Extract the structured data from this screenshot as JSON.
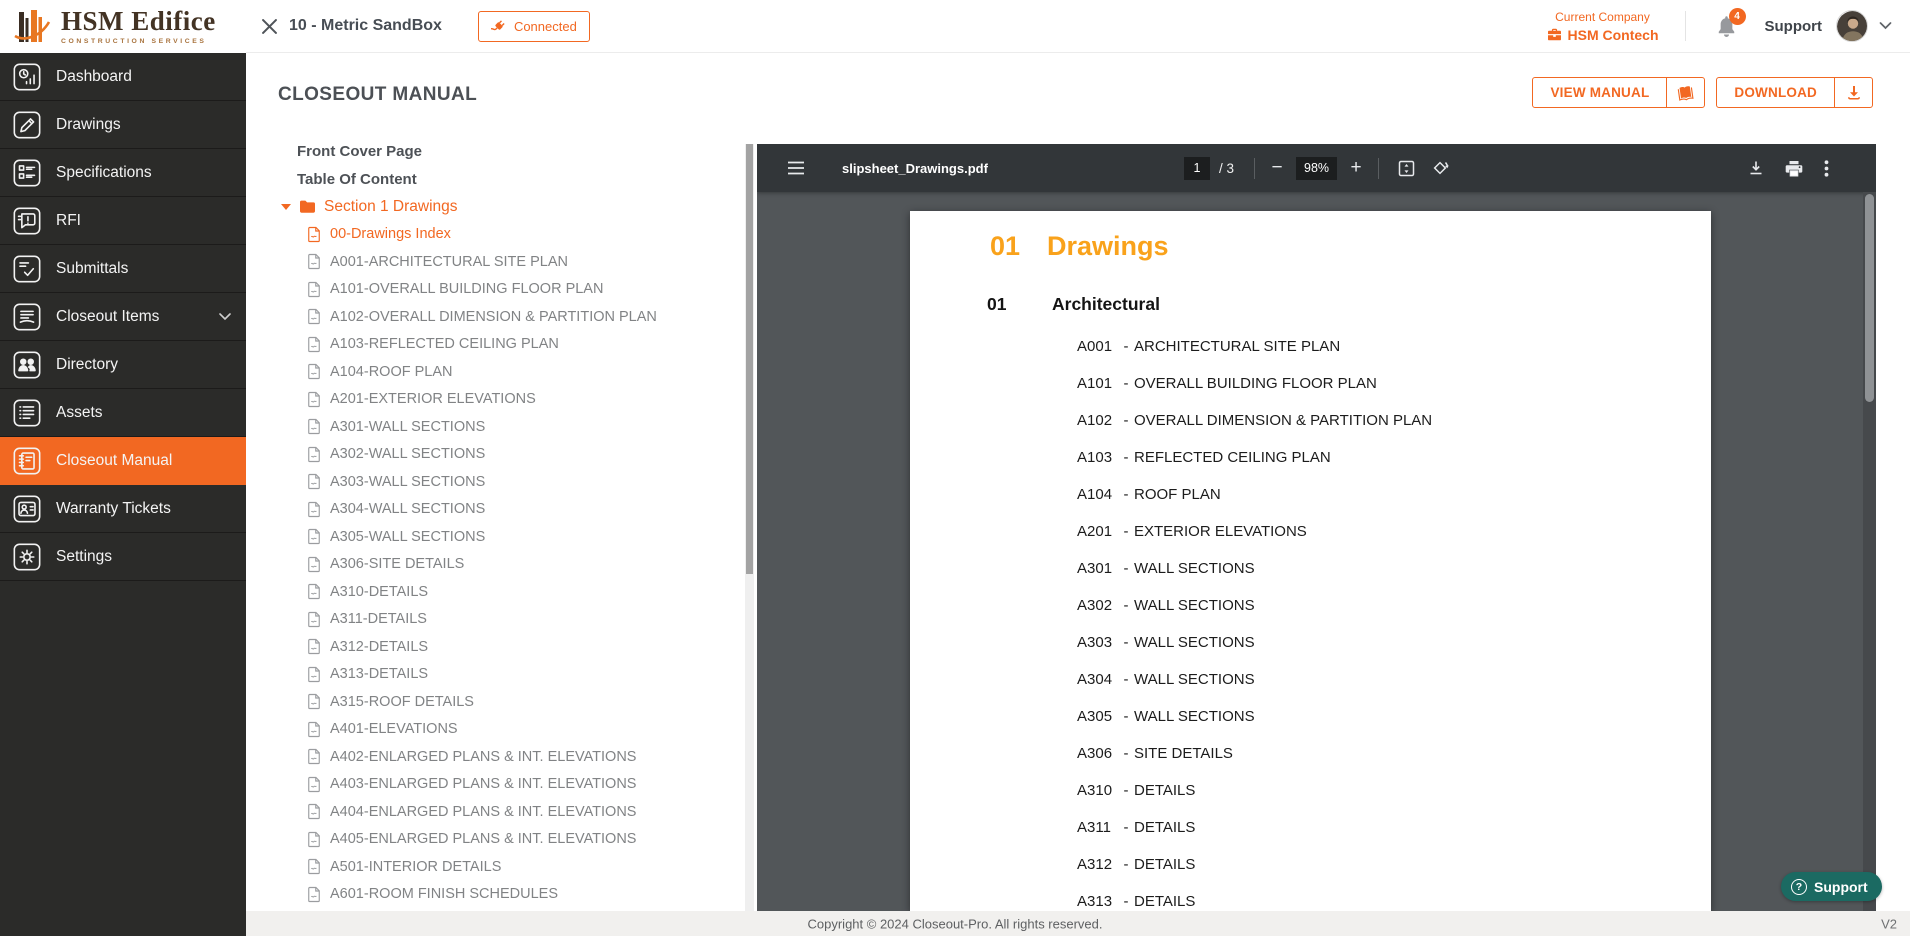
{
  "colors": {
    "accent_orange": "#f26822",
    "amber_heading": "#f9a21b",
    "sidebar_bg": "#2b2b29",
    "pdf_toolbar_bg": "#323639",
    "pdf_viewer_bg": "#525659",
    "support_teal": "#1b6a62"
  },
  "logo": {
    "title": "HSM Edifice",
    "subtitle": "CONSTRUCTION SERVICES"
  },
  "header": {
    "project_title": "10 - Metric SandBox",
    "connection_status": "Connected",
    "current_company_label": "Current Company",
    "current_company": "HSM Contech",
    "notification_count": "4",
    "support_label": "Support"
  },
  "sidebar": {
    "items": [
      {
        "id": "dashboard",
        "label": "Dashboard",
        "icon": "dashboard"
      },
      {
        "id": "drawings",
        "label": "Drawings",
        "icon": "drawings"
      },
      {
        "id": "specifications",
        "label": "Specifications",
        "icon": "specifications"
      },
      {
        "id": "rfi",
        "label": "RFI",
        "icon": "rfi"
      },
      {
        "id": "submittals",
        "label": "Submittals",
        "icon": "submittals"
      },
      {
        "id": "closeout-items",
        "label": "Closeout Items",
        "icon": "closeout-items",
        "has_chevron": true
      },
      {
        "id": "directory",
        "label": "Directory",
        "icon": "directory"
      },
      {
        "id": "assets",
        "label": "Assets",
        "icon": "assets"
      },
      {
        "id": "closeout-manual",
        "label": "Closeout Manual",
        "icon": "closeout-manual",
        "active": true
      },
      {
        "id": "warranty-tickets",
        "label": "Warranty Tickets",
        "icon": "warranty-tickets"
      },
      {
        "id": "settings",
        "label": "Settings",
        "icon": "settings"
      }
    ]
  },
  "page": {
    "title": "CLOSEOUT MANUAL",
    "view_manual_label": "VIEW MANUAL",
    "download_label": "DOWNLOAD"
  },
  "tree": {
    "static_items": [
      "Front Cover Page",
      "Table Of Content"
    ],
    "section_label": "Section 1 Drawings",
    "selected_index": 0,
    "files": [
      "00-Drawings Index",
      "A001-ARCHITECTURAL SITE PLAN",
      "A101-OVERALL BUILDING FLOOR PLAN",
      "A102-OVERALL DIMENSION & PARTITION PLAN",
      "A103-REFLECTED CEILING PLAN",
      "A104-ROOF PLAN",
      "A201-EXTERIOR ELEVATIONS",
      "A301-WALL SECTIONS",
      "A302-WALL SECTIONS",
      "A303-WALL SECTIONS",
      "A304-WALL SECTIONS",
      "A305-WALL SECTIONS",
      "A306-SITE DETAILS",
      "A310-DETAILS",
      "A311-DETAILS",
      "A312-DETAILS",
      "A313-DETAILS",
      "A315-ROOF DETAILS",
      "A401-ELEVATIONS",
      "A402-ENLARGED PLANS & INT. ELEVATIONS",
      "A403-ENLARGED PLANS & INT. ELEVATIONS",
      "A404-ENLARGED PLANS & INT. ELEVATIONS",
      "A405-ENLARGED PLANS & INT. ELEVATIONS",
      "A501-INTERIOR DETAILS",
      "A601-ROOM FINISH SCHEDULES"
    ]
  },
  "pdf_viewer": {
    "filename": "slipsheet_Drawings.pdf",
    "page_current": "1",
    "page_separator": "/",
    "page_total": "3",
    "zoom_level": "98%",
    "minus_sign": "−",
    "plus_sign": "+",
    "toolbar_icons": [
      "menu-icon",
      "page-fit-icon",
      "rotate-icon",
      "download-icon",
      "print-icon",
      "more-vertical-icon"
    ],
    "document": {
      "section_number": "01",
      "section_title": "Drawings",
      "subsection_number": "01",
      "subsection_title": "Architectural",
      "entry_dash": "-",
      "entries": [
        {
          "code": "A001",
          "name": "ARCHITECTURAL SITE PLAN"
        },
        {
          "code": "A101",
          "name": "OVERALL BUILDING FLOOR PLAN"
        },
        {
          "code": "A102",
          "name": "OVERALL DIMENSION & PARTITION PLAN"
        },
        {
          "code": "A103",
          "name": "REFLECTED CEILING PLAN"
        },
        {
          "code": "A104",
          "name": "ROOF PLAN"
        },
        {
          "code": "A201",
          "name": "EXTERIOR ELEVATIONS"
        },
        {
          "code": "A301",
          "name": "WALL SECTIONS"
        },
        {
          "code": "A302",
          "name": "WALL SECTIONS"
        },
        {
          "code": "A303",
          "name": "WALL SECTIONS"
        },
        {
          "code": "A304",
          "name": "WALL SECTIONS"
        },
        {
          "code": "A305",
          "name": "WALL SECTIONS"
        },
        {
          "code": "A306",
          "name": "SITE DETAILS"
        },
        {
          "code": "A310",
          "name": "DETAILS"
        },
        {
          "code": "A311",
          "name": "DETAILS"
        },
        {
          "code": "A312",
          "name": "DETAILS"
        },
        {
          "code": "A313",
          "name": "DETAILS"
        }
      ]
    }
  },
  "footer": {
    "copyright": "Copyright © 2024 Closeout-Pro. All rights reserved.",
    "version": "V2",
    "support_button": "Support"
  }
}
